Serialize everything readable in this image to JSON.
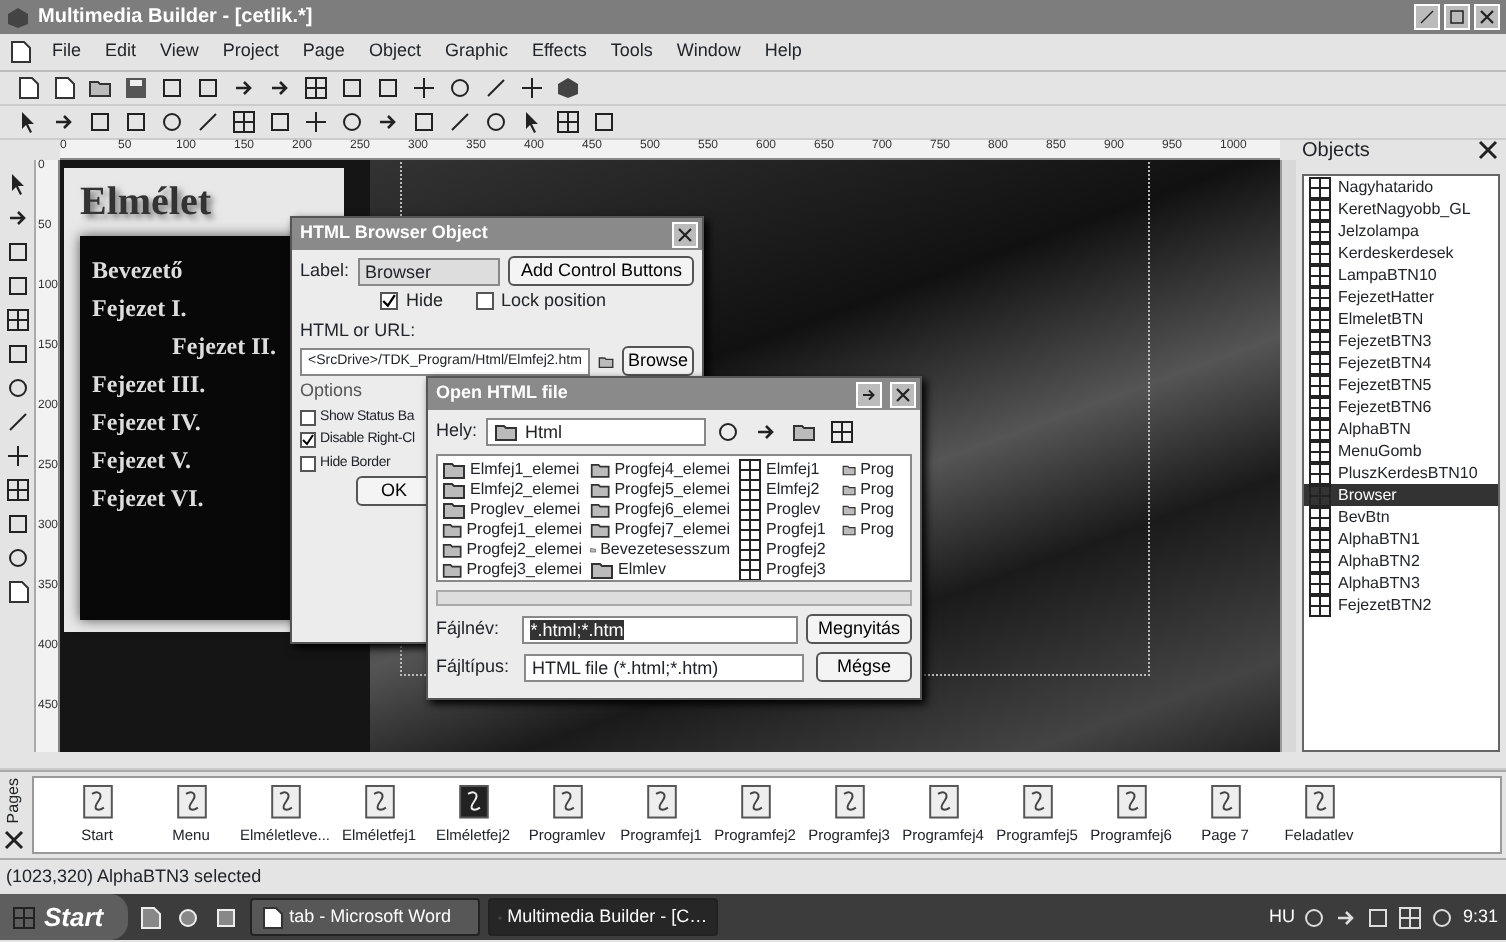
{
  "window": {
    "title": "Multimedia Builder - [cetlik.*]"
  },
  "menu": [
    "File",
    "Edit",
    "View",
    "Project",
    "Page",
    "Object",
    "Graphic",
    "Effects",
    "Tools",
    "Window",
    "Help"
  ],
  "ruler": {
    "labels": [
      "0",
      "50",
      "100",
      "150",
      "200",
      "250",
      "300",
      "350",
      "400",
      "450",
      "500",
      "550",
      "600",
      "650",
      "700",
      "750",
      "800",
      "850",
      "900",
      "950",
      "1000"
    ]
  },
  "vertical_ruler": {
    "labels": [
      "0",
      "50",
      "100",
      "150",
      "200",
      "250",
      "300",
      "350",
      "400",
      "450"
    ]
  },
  "objects_panel": {
    "title": "Objects",
    "items": [
      {
        "name": "Nagyhatarido",
        "selected": false
      },
      {
        "name": "KeretNagyobb_GL",
        "selected": false
      },
      {
        "name": "Jelzolampa",
        "selected": false
      },
      {
        "name": "Kerdeskerdesek",
        "selected": false
      },
      {
        "name": "LampaBTN10",
        "selected": false
      },
      {
        "name": "FejezetHatter",
        "selected": false
      },
      {
        "name": "ElmeletBTN",
        "selected": false
      },
      {
        "name": "FejezetBTN3",
        "selected": false
      },
      {
        "name": "FejezetBTN4",
        "selected": false
      },
      {
        "name": "FejezetBTN5",
        "selected": false
      },
      {
        "name": "FejezetBTN6",
        "selected": false
      },
      {
        "name": "AlphaBTN",
        "selected": false
      },
      {
        "name": "MenuGomb",
        "selected": false
      },
      {
        "name": "PluszKerdesBTN10",
        "selected": false
      },
      {
        "name": "Browser",
        "selected": true
      },
      {
        "name": "BevBtn",
        "selected": false
      },
      {
        "name": "AlphaBTN1",
        "selected": false
      },
      {
        "name": "AlphaBTN2",
        "selected": false
      },
      {
        "name": "AlphaBTN3",
        "selected": false
      },
      {
        "name": "FejezetBTN2",
        "selected": false
      }
    ]
  },
  "canvas": {
    "menu_panel": {
      "title": "Elmélet",
      "items": [
        "Bevezető",
        "Fejezet I.",
        "Fejezet II.",
        "Fejezet III.",
        "Fejezet IV.",
        "Fejezet V.",
        "Fejezet VI."
      ]
    }
  },
  "browser_dialog": {
    "title": "HTML Browser Object",
    "label_caption": "Label:",
    "label_value": "Browser",
    "add_buttons": "Add Control Buttons",
    "checkboxes": [
      {
        "label": "Hide",
        "checked": true
      },
      {
        "label": "Lock position",
        "checked": false
      }
    ],
    "url_caption": "HTML or URL:",
    "url_value": "<SrcDrive>/TDK_Program/Html/Elmfej2.htm",
    "browse": "Browse",
    "options_title": "Options",
    "options": [
      {
        "label": "Show Status Ba",
        "checked": false
      },
      {
        "label": "Disable Right-Cl",
        "checked": true
      },
      {
        "label": "Hide Border",
        "checked": false
      }
    ],
    "ok": "OK"
  },
  "open_dialog": {
    "title": "Open HTML file",
    "location_caption": "Hely:",
    "location": "Html",
    "files": [
      [
        "Elmfej1_elemei",
        "Elmfej2_elemei",
        "Proglev_elemei",
        "Progfej1_elemei",
        "Progfej2_elemei",
        "Progfej3_elemei"
      ],
      [
        "Progfej4_elemei",
        "Progfej5_elemei",
        "Progfej6_elemei",
        "Progfej7_elemei",
        "Bevezetesesszum",
        "Elmlev"
      ],
      [
        "Elmfej1",
        "Elmfej2",
        "Proglev",
        "Progfej1",
        "Progfej2",
        "Progfej3"
      ],
      [
        "Prog",
        "Prog",
        "Prog",
        "Prog"
      ]
    ],
    "filename_caption": "Fájlnév:",
    "filename": "*.html;*.htm",
    "open": "Megnyitás",
    "filetype_caption": "Fájltípus:",
    "filetype": "HTML file (*.html;*.htm)",
    "cancel": "Mégse"
  },
  "pages": {
    "title": "Pages",
    "items": [
      {
        "label": "Start",
        "selected": false
      },
      {
        "label": "Menu",
        "selected": false
      },
      {
        "label": "Elméletleve...",
        "selected": false
      },
      {
        "label": "Elméletfej1",
        "selected": false
      },
      {
        "label": "Elméletfej2",
        "selected": true
      },
      {
        "label": "Programlev",
        "selected": false
      },
      {
        "label": "Programfej1",
        "selected": false
      },
      {
        "label": "Programfej2",
        "selected": false
      },
      {
        "label": "Programfej3",
        "selected": false
      },
      {
        "label": "Programfej4",
        "selected": false
      },
      {
        "label": "Programfej5",
        "selected": false
      },
      {
        "label": "Programfej6",
        "selected": false
      },
      {
        "label": "Page 7",
        "selected": false
      },
      {
        "label": "Feladatlev",
        "selected": false
      }
    ]
  },
  "status_bar": "(1023,320)  AlphaBTN3 selected",
  "taskbar": {
    "start": "Start",
    "tasks": [
      {
        "label": "tab - Microsoft Word",
        "selected": false
      },
      {
        "label": "Multimedia Builder - [C…",
        "selected": true
      }
    ],
    "language": "HU",
    "clock": "9:31"
  }
}
